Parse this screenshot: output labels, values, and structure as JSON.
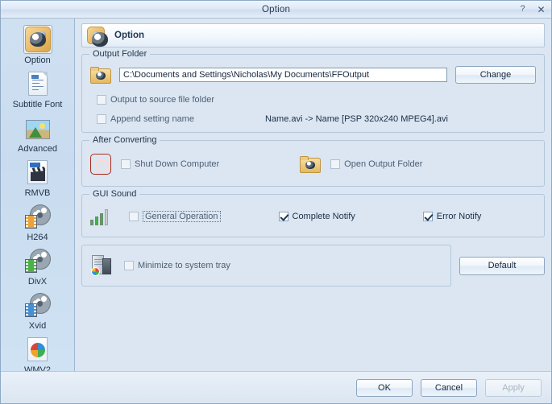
{
  "window": {
    "title": "Option",
    "help_label": "?",
    "close_label": "✕"
  },
  "sidebar": {
    "items": [
      {
        "label": "Option",
        "icon": "option-icon",
        "selected": true
      },
      {
        "label": "Subtitle Font",
        "icon": "subtitle-font-icon",
        "selected": false
      },
      {
        "label": "Advanced",
        "icon": "advanced-icon",
        "selected": false
      },
      {
        "label": "RMVB",
        "icon": "rmvb-icon",
        "selected": false
      },
      {
        "label": "H264",
        "icon": "h264-icon",
        "selected": false
      },
      {
        "label": "DivX",
        "icon": "divx-icon",
        "selected": false
      },
      {
        "label": "Xvid",
        "icon": "xvid-icon",
        "selected": false
      },
      {
        "label": "WMV2",
        "icon": "wmv2-icon",
        "selected": false
      }
    ]
  },
  "page_header": {
    "title": "Option",
    "icon": "option-icon"
  },
  "output_folder": {
    "legend": "Output Folder",
    "folder_icon": "folder-icon",
    "path_value": "C:\\Documents and Settings\\Nicholas\\My Documents\\FFOutput",
    "path_placeholder": "Output folder path",
    "change_button": "Change",
    "output_to_source": {
      "label": "Output to source file folder",
      "checked": false,
      "enabled": false
    },
    "append_setting_name": {
      "label": "Append setting name",
      "checked": false,
      "enabled": false
    },
    "append_example": "Name.avi  -> Name [PSP 320x240 MPEG4].avi"
  },
  "after_converting": {
    "legend": "After Converting",
    "shutdown": {
      "label": "Shut Down Computer",
      "checked": false,
      "enabled": false,
      "icon": "power-icon"
    },
    "open_output": {
      "label": "Open Output Folder",
      "checked": false,
      "enabled": false,
      "icon": "folder-icon"
    }
  },
  "gui_sound": {
    "legend": "GUI Sound",
    "icon": "sound-bars-icon",
    "general_operation": {
      "label": "General Operation",
      "checked": false,
      "enabled": false,
      "focused": true
    },
    "complete_notify": {
      "label": "Complete Notify",
      "checked": true,
      "enabled": true
    },
    "error_notify": {
      "label": "Error Notify",
      "checked": true,
      "enabled": true
    }
  },
  "tray": {
    "icon": "computer-icon",
    "minimize_to_tray": {
      "label": "Minimize to system tray",
      "checked": false,
      "enabled": false
    },
    "default_button": "Default"
  },
  "footer": {
    "ok": "OK",
    "cancel": "Cancel",
    "apply": "Apply",
    "apply_enabled": false
  },
  "colors": {
    "window_bg": "#dbe6f2",
    "sidebar_bg": "#cfe0f1",
    "group_border": "#b3c7db",
    "text": "#1b2e45",
    "accent_red": "#e0412a",
    "accent_green": "#43b34a",
    "folder_gold": "#e3b960"
  }
}
